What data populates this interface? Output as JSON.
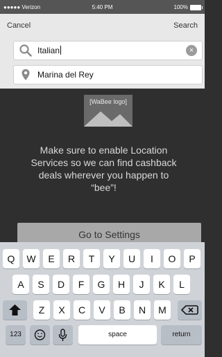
{
  "statusbar": {
    "carrier": "●●●●● Verizon",
    "time": "5:40 PM",
    "battery": "100%"
  },
  "nav": {
    "cancel_label": "Cancel",
    "search_label": "Search"
  },
  "search": {
    "value": "Italian"
  },
  "location": {
    "value": "Marina del Rey"
  },
  "logo": {
    "label": "[WaBee logo]"
  },
  "message": {
    "text": "Make sure to enable Location Services so we can find cashback deals wherever you happen to “bee”!"
  },
  "settings_button": {
    "label": "Go to Settings"
  },
  "keyboard": {
    "row1": [
      "Q",
      "W",
      "E",
      "R",
      "T",
      "Y",
      "U",
      "I",
      "O",
      "P"
    ],
    "row2": [
      "A",
      "S",
      "D",
      "F",
      "G",
      "H",
      "J",
      "K",
      "L"
    ],
    "row3": [
      "Z",
      "X",
      "C",
      "V",
      "B",
      "N",
      "M"
    ],
    "row4": {
      "numbers": "123",
      "space": "space",
      "return": "return"
    }
  },
  "colors": {
    "dark_bg": "#2f2f2f",
    "top_panel": "#e8e8e8",
    "keyboard_bg": "#cfd3d8",
    "button_gray": "#a8a8a8"
  },
  "icons": {
    "search": "magnifier-icon",
    "clear": "clear-icon",
    "location": "map-pin-icon",
    "shift": "shift-icon",
    "backspace": "backspace-icon",
    "emoji": "emoji-icon",
    "mic": "microphone-icon"
  }
}
